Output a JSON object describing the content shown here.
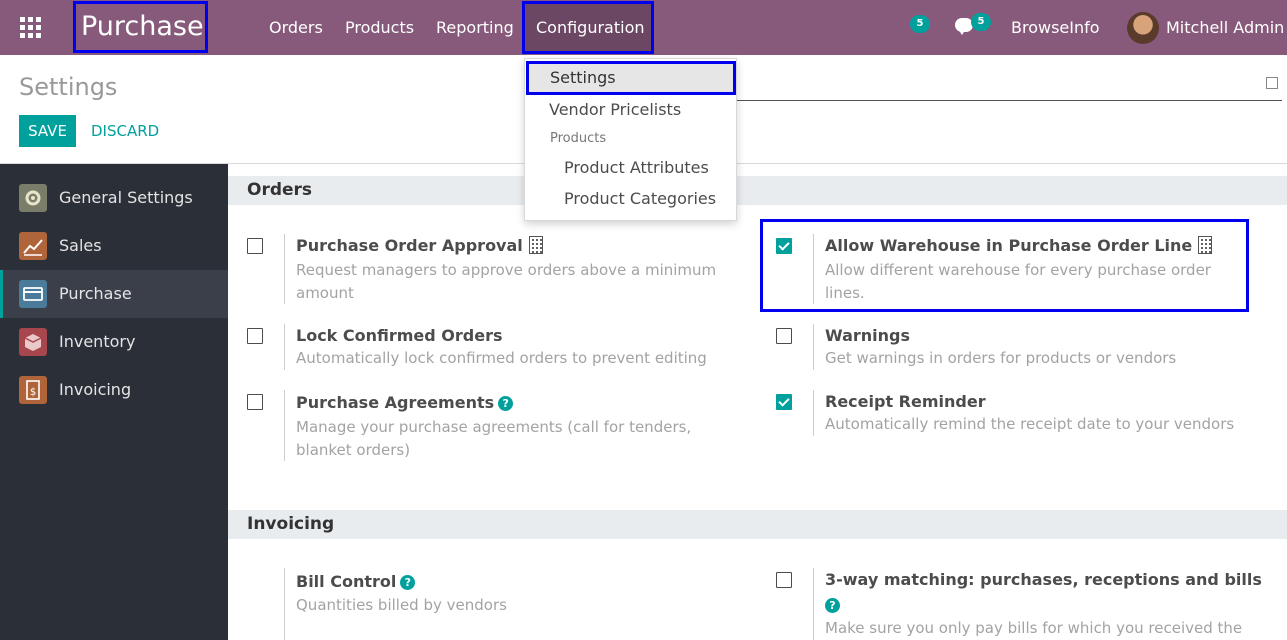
{
  "navbar": {
    "brand": "Purchase",
    "menus": [
      "Orders",
      "Products",
      "Reporting",
      "Configuration"
    ],
    "activity_count": "5",
    "messages_count": "5",
    "company": "BrowseInfo",
    "user": "Mitchell Admin"
  },
  "control_panel": {
    "title": "Settings",
    "save_label": "SAVE",
    "discard_label": "DISCARD"
  },
  "configuration_menu": {
    "items": [
      "Settings",
      "Vendor Pricelists"
    ],
    "products_header": "Products",
    "product_items": [
      "Product Attributes",
      "Product Categories"
    ]
  },
  "sidebar": {
    "items": [
      {
        "label": "General Settings",
        "icon": "gear-icon",
        "color": "#7a7d6a"
      },
      {
        "label": "Sales",
        "icon": "chart-icon",
        "color": "#b0643a"
      },
      {
        "label": "Purchase",
        "icon": "credit-card-icon",
        "color": "#4b7b9b"
      },
      {
        "label": "Inventory",
        "icon": "box-icon",
        "color": "#a8464e"
      },
      {
        "label": "Invoicing",
        "icon": "invoice-icon",
        "color": "#b0643a"
      }
    ],
    "active": "Purchase"
  },
  "sections": {
    "orders": {
      "title": "Orders",
      "options": [
        {
          "title": "Purchase Order Approval",
          "desc": "Request managers to approve orders above a minimum amount",
          "checked": false
        },
        {
          "title": "Allow Warehouse in Purchase Order Line",
          "desc": "Allow different warehouse for every purchase order lines.",
          "checked": true
        },
        {
          "title": "Lock Confirmed Orders",
          "desc": "Automatically lock confirmed orders to prevent editing",
          "checked": false
        },
        {
          "title": "Warnings",
          "desc": "Get warnings in orders for products or vendors",
          "checked": false
        },
        {
          "title": "Purchase Agreements",
          "desc": "Manage your purchase agreements (call for tenders, blanket orders)",
          "checked": false
        },
        {
          "title": "Receipt Reminder",
          "desc": "Automatically remind the receipt date to your vendors",
          "checked": true
        }
      ]
    },
    "invoicing": {
      "title": "Invoicing",
      "options": [
        {
          "title": "Bill Control",
          "desc": "Quantities billed by vendors"
        },
        {
          "title": "3-way matching: purchases, receptions and bills",
          "desc": "Make sure you only pay bills for which you received the",
          "checked": false
        }
      ]
    }
  },
  "colors": {
    "navbar": "#875a7b",
    "accent": "#00a09d",
    "sidebar": "#2b2f38",
    "highlight_border": "#0000ee"
  }
}
